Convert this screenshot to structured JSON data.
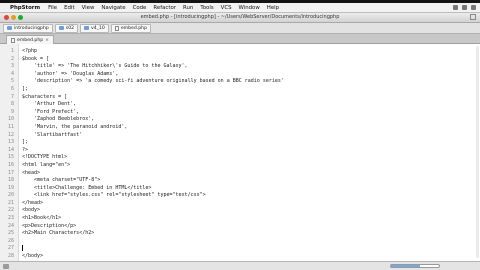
{
  "menubar": {
    "app_name": "PhpStorm",
    "items": [
      "File",
      "Edit",
      "View",
      "Navigate",
      "Code",
      "Refactor",
      "Run",
      "Tools",
      "VCS",
      "Window",
      "Help"
    ]
  },
  "window": {
    "title": "embed.php - [introducingphp] - ~/Users/WebServer/Documents/introducingphp"
  },
  "breadcrumbs": [
    {
      "label": "introducingphp",
      "icon": "folder-icon"
    },
    {
      "label": "s02",
      "icon": "folder-icon"
    },
    {
      "label": "v4_10",
      "icon": "folder-icon"
    },
    {
      "label": "embed.php",
      "icon": "file-icon"
    }
  ],
  "tab": {
    "label": "embed.php"
  },
  "status": {
    "progress_fraction": 0.6
  },
  "code_lines": [
    "<?php",
    "$book = [",
    "    'title' => 'The Hitchhiker\\'s Guide to the Galaxy',",
    "    'author' => 'Douglas Adams',",
    "    'description' => 'a comedy sci-fi adventure originally based on a BBC radio series'",
    "];",
    "$characters = [",
    "    'Arthur Dent',",
    "    'Ford Prefect',",
    "    'Zaphod Beeblebrox',",
    "    'Marvin, the paranoid android',",
    "    'Slartibartfast'",
    "];",
    "?>",
    "<!DOCTYPE html>",
    "<html lang=\"en\">",
    "<head>",
    "    <meta charset=\"UTF-8\">",
    "    <title>Challenge: Embed in HTML</title>",
    "    <link href=\"styles.css\" rel=\"stylesheet\" type=\"text/css\">",
    "</head>",
    "<body>",
    "<h1>Book</h1>",
    "<p>Description</p>",
    "<h2>Main Characters</h2>",
    "",
    "",
    "</body>",
    "</html>"
  ],
  "colors": {
    "accent": "#7aa7e0",
    "editor_bg": "#ffffff"
  }
}
